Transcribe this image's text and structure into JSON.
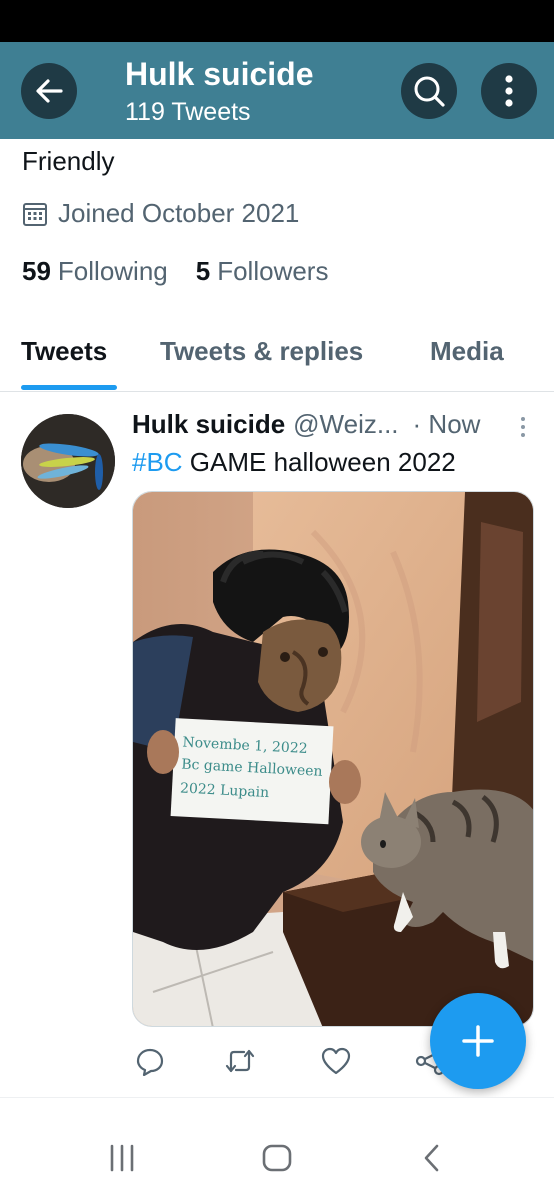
{
  "header": {
    "title": "Hulk suicide",
    "subtitle": "119 Tweets",
    "bar_color": "#3f7f93",
    "button_color": "#1f3a45"
  },
  "profile": {
    "bio": "Friendly",
    "joined": "Joined October 2021",
    "following_count": "59",
    "following_label": "Following",
    "followers_count": "5",
    "followers_label": "Followers"
  },
  "tabs": [
    {
      "label": "Tweets",
      "active": true
    },
    {
      "label": "Tweets & replies",
      "active": false
    },
    {
      "label": "Media",
      "active": false
    }
  ],
  "tweet": {
    "name": "Hulk suicide",
    "handle": "@Weiz...",
    "time": "· Now",
    "hashtag": "#BC",
    "text": " GAME halloween 2022",
    "media": {
      "sign_lines": [
        "Novembe 1, 2022",
        "Bc game Halloween",
        "2022 Lupain"
      ]
    }
  },
  "icons": {
    "back": "arrow-left-icon",
    "search": "search-icon",
    "more": "more-vertical-icon",
    "calendar": "calendar-icon",
    "reply": "reply-icon",
    "retweet": "retweet-icon",
    "like": "heart-icon",
    "share": "share-icon",
    "compose": "plus-icon",
    "nav_recents": "recents-icon",
    "nav_home": "home-icon",
    "nav_back": "back-chevron-icon"
  },
  "colors": {
    "accent": "#1d9bf0",
    "primary_text": "#0f1419",
    "secondary_text": "#536471"
  }
}
